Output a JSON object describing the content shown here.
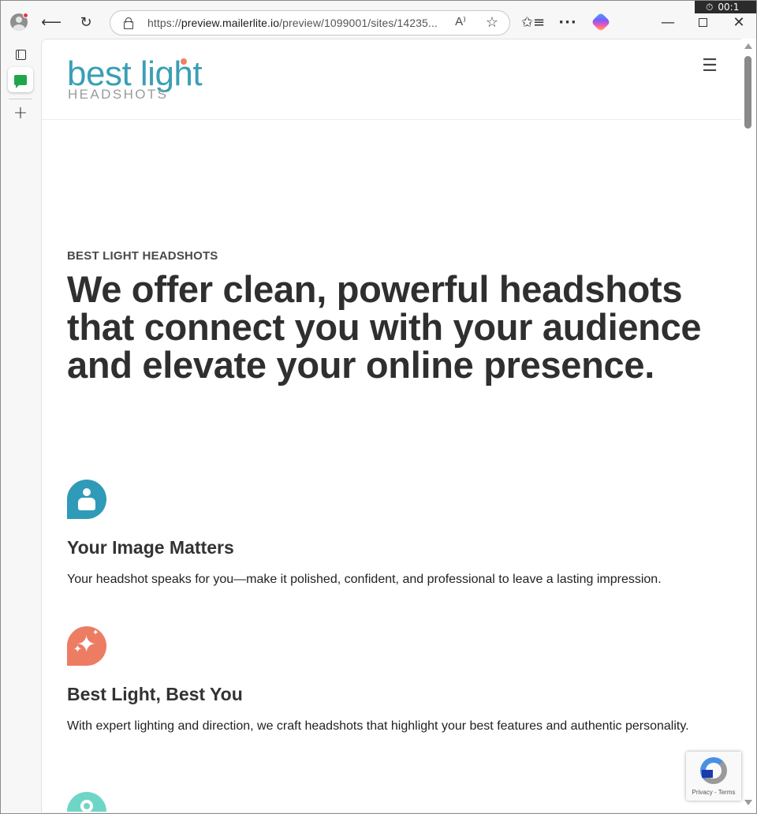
{
  "browser": {
    "url_prefix": "https://",
    "url_host": "preview.mailerlite.io",
    "url_path": "/preview/1099001/sites/14235...",
    "timer": "00:1",
    "icons": {
      "profile": "profile-icon",
      "back": "back-arrow-icon",
      "reload": "reload-icon",
      "lock": "lock-icon",
      "read_aloud": "read-aloud-icon",
      "favorite": "star-icon",
      "favorites": "favorites-icon",
      "more": "more-icon",
      "copilot": "copilot-icon",
      "minimize": "minimize-icon",
      "maximize": "maximize-icon",
      "close": "close-icon"
    },
    "glyphs": {
      "back": "⟵",
      "reload": "↻",
      "read_aloud": "A⁾",
      "favorite": "☆",
      "favorites": "✩≡",
      "more": "···",
      "minimize": "—",
      "close": "✕",
      "timer_icon": "⏱",
      "new_tab": "+"
    }
  },
  "site": {
    "logo_word": "best light",
    "logo_sub": "HEADSHOTS",
    "menu_glyph": "☰",
    "eyebrow": "BEST LIGHT HEADSHOTS",
    "headline": "We offer clean, powerful headshots that connect you with your audience and elevate your online presence.",
    "features": [
      {
        "title": "Your Image Matters",
        "text": "Your headshot speaks for you—make it polished, confident, and professional to leave a lasting impression.",
        "icon": "person-icon",
        "color": "#2f9bb8"
      },
      {
        "title": "Best Light, Best You",
        "text": "With expert lighting and direction, we craft headshots that highlight your best features and authentic personality.",
        "icon": "sparkle-icon",
        "color": "#ec7d63"
      },
      {
        "icon": "location-pin-icon",
        "color": "#6ed6c6"
      }
    ],
    "colors": {
      "brand": "#3a9fb5",
      "accent": "#ef7f66",
      "heading": "#2f2f2f"
    }
  },
  "recaptcha": {
    "links": "Privacy - Terms"
  }
}
